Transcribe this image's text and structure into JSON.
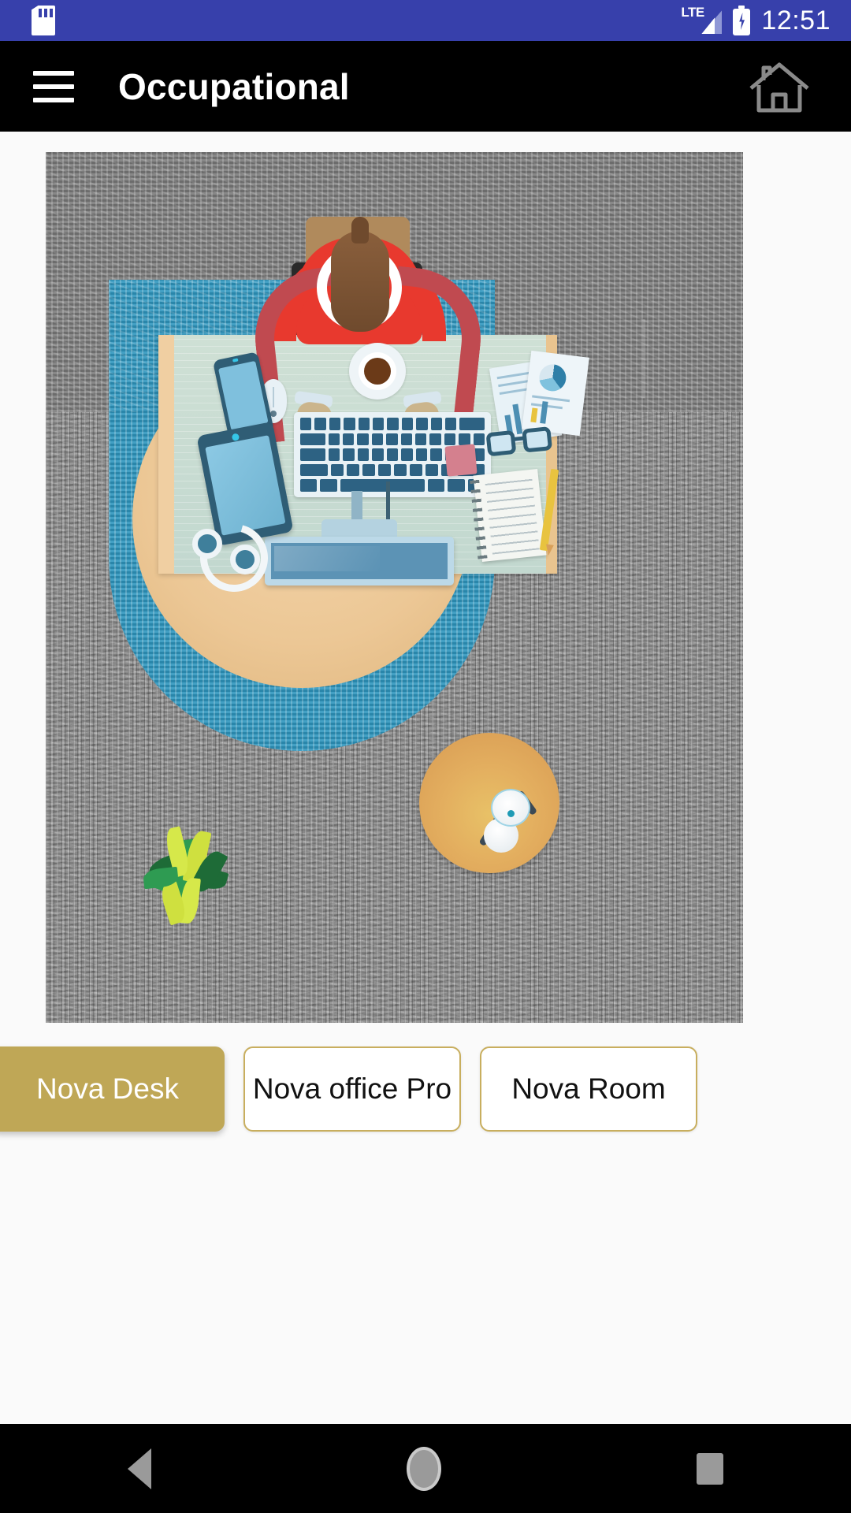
{
  "status_bar": {
    "background_color": "#3740ab",
    "sd_card_icon": "sd-card-icon",
    "network_label": "LTE",
    "battery_icon": "battery-charging-icon",
    "time": "12:51"
  },
  "app_bar": {
    "background_color": "#000000",
    "menu_icon": "hamburger-menu-icon",
    "title": "Occupational",
    "home_icon": "home-icon"
  },
  "main": {
    "hero_image": {
      "name": "occupational-workspace-illustration",
      "description": "Top-down illustration of a person in a red shirt seated at a desk with keyboard, monitor, mouse, phone, tablet, coffee cup, headphones, notebook and papers on a gray carpet, with an orange round side table holding a desk lamp and a potted plant."
    },
    "buttons": [
      {
        "label": "Nova Desk",
        "selected": true,
        "fill_color": "#bfa756",
        "text_color": "#ffffff"
      },
      {
        "label": "Nova office Pro",
        "selected": false,
        "fill_color": "#ffffff",
        "text_color": "#111111"
      },
      {
        "label": "Nova Room",
        "selected": false,
        "fill_color": "#ffffff",
        "text_color": "#111111"
      }
    ]
  },
  "nav_bar": {
    "background_color": "#000000",
    "back_icon": "back-triangle-icon",
    "home_icon": "home-circle-icon",
    "recents_icon": "recents-square-icon"
  }
}
